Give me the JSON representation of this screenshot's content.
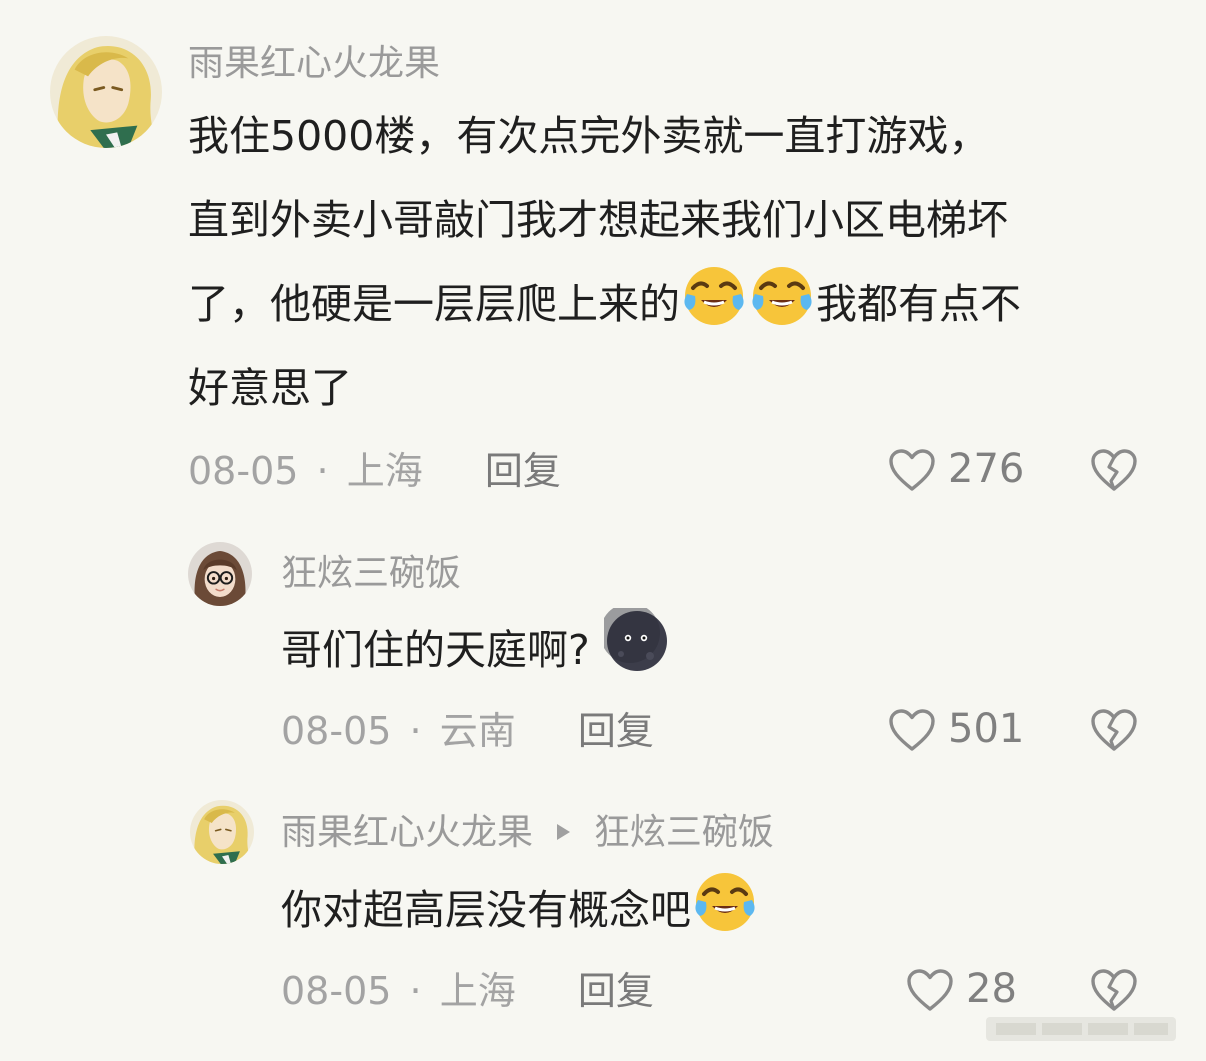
{
  "comments": [
    {
      "username": "雨果红心火龙果",
      "text_line1": "我住5000楼，有次点完外卖就一直打游戏，",
      "text_line2": "直到外卖小哥敲门我才想起来我们小区电梯坏",
      "text_line3_a": "了，他硬是一层层爬上来的",
      "text_line3_b": "我都有点不",
      "text_line4": "好意思了",
      "emojis": [
        "crying-laughing-emoji",
        "crying-laughing-emoji"
      ],
      "date": "08-05",
      "location": "上海",
      "reply_label": "回复",
      "likes": "276"
    },
    {
      "username": "狂炫三碗饭",
      "text": "哥们住的天庭啊?",
      "emoji": "dark-moon-face-emoji",
      "date": "08-05",
      "location": "云南",
      "reply_label": "回复",
      "likes": "501"
    },
    {
      "username": "雨果红心火龙果",
      "reply_to": "狂炫三碗饭",
      "text": "你对超高层没有概念吧",
      "emoji": "crying-laughing-emoji",
      "date": "08-05",
      "location": "上海",
      "reply_label": "回复",
      "likes": "28"
    }
  ],
  "separator": "·",
  "icons": {
    "like": "heart-outline-icon",
    "dislike": "broken-heart-icon",
    "reply_arrow": "triangle-right-icon"
  },
  "colors": {
    "background": "#f7f7f2",
    "username": "#9a9a9a",
    "text": "#1f1f1f",
    "meta": "#a3a3a3"
  }
}
